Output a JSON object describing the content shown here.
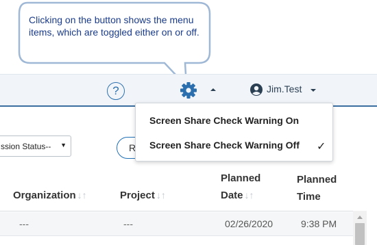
{
  "callout": {
    "text": "Clicking on the button shows the menu items, which are toggled either on or off."
  },
  "topbar": {
    "help_symbol": "?",
    "username": "Jim.Test"
  },
  "filters": {
    "status_select_value": "ssion Status--",
    "status_arrow": "▼",
    "reset_button_partial": "R"
  },
  "menu": {
    "items": [
      {
        "label": "Screen Share Check Warning On",
        "checked": false
      },
      {
        "label": "Screen Share Check Warning Off",
        "checked": true
      }
    ],
    "check_glyph": "✓"
  },
  "table": {
    "headers": {
      "organization": "Organization",
      "project": "Project",
      "planned_date_line1": "Planned",
      "planned_date_line2": "Date",
      "planned_time_line1": "Planned",
      "planned_time_line2": "Time"
    },
    "sort_glyph": "↓↑",
    "rows": [
      {
        "organization": "---",
        "project": "---",
        "planned_date": "02/26/2020",
        "planned_time": "9:38 PM"
      }
    ]
  },
  "colors": {
    "accent_blue": "#2c6fae",
    "callout_text": "#1a3b8a",
    "callout_border": "#9fb8d6"
  }
}
